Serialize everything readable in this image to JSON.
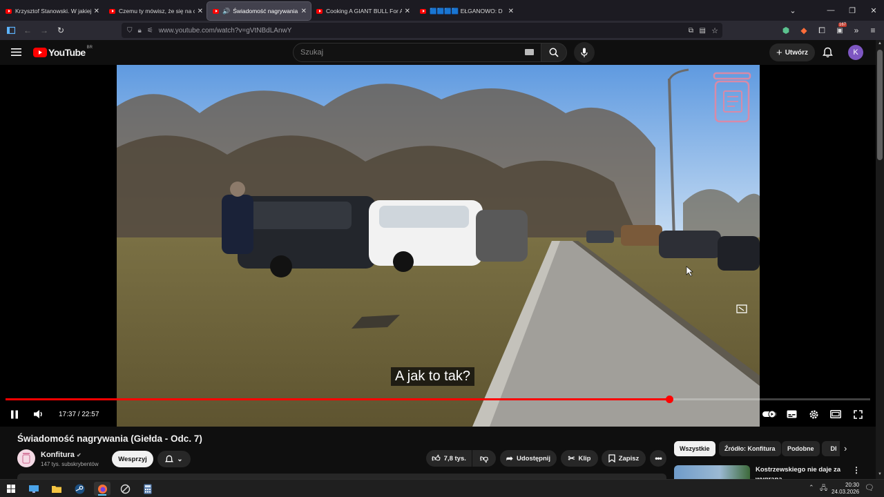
{
  "browser": {
    "tabs": [
      {
        "title": "Krzysztof Stanowski. W jakiej sp",
        "active": false
      },
      {
        "title": "Czemu ty mówisz, że się na cie",
        "active": false
      },
      {
        "title": "Świadomość nagrywania (G",
        "active": true
      },
      {
        "title": "Cooking A GIANT BULL For A G",
        "active": false
      },
      {
        "title": "🟦🟦🟦🟦 EŁGANOWO: D",
        "active": false
      }
    ],
    "url": "www.youtube.com/watch?v=gVtNBdLAnwY",
    "notification_count": "167"
  },
  "youtube": {
    "logo": "YouTube",
    "region": "BR",
    "search_placeholder": "Szukaj",
    "create_label": "Utwórz",
    "avatar_letter": "K"
  },
  "player": {
    "caption": "A jak to tak?",
    "time": "17:37 / 22:57",
    "progress": 0.7675,
    "progress_color": "#ff0000"
  },
  "video_info": {
    "title": "Świadomość nagrywania (Giełda - Odc. 7)",
    "channel": "Konfitura",
    "subscribers": "147 tys. subskrybentów",
    "support_label": "Wesprzyj",
    "likes": "7,8 tys.",
    "share_label": "Udostępnij",
    "clip_label": "Klip",
    "save_label": "Zapisz"
  },
  "recommendations": {
    "chips": [
      "Wszystkie",
      "Źródło: Konfitura",
      "Podobne",
      "Dl"
    ],
    "first_title": "Kostrzewskiego nie daje za wygraną"
  },
  "taskbar": {
    "time": "20:30",
    "date": "24.03.2026"
  }
}
